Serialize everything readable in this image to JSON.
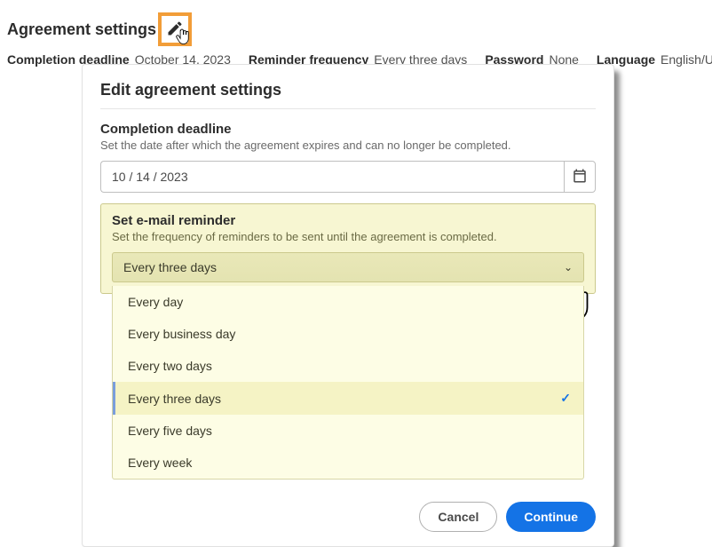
{
  "header": {
    "title": "Agreement settings",
    "items": [
      {
        "label": "Completion deadline",
        "value": "October 14, 2023"
      },
      {
        "label": "Reminder frequency",
        "value": "Every three days"
      },
      {
        "label": "Password",
        "value": "None"
      },
      {
        "label": "Language",
        "value": "English/UK"
      }
    ]
  },
  "modal": {
    "title": "Edit agreement settings",
    "deadline": {
      "label": "Completion deadline",
      "desc": "Set the date after which the agreement expires and can no longer be completed.",
      "value": "10 / 14 / 2023"
    },
    "reminder": {
      "label": "Set e-mail reminder",
      "desc": "Set the frequency of reminders to be sent until the agreement is completed.",
      "selected": "Every three days",
      "options": [
        "Every day",
        "Every business day",
        "Every two days",
        "Every three days",
        "Every five days",
        "Every week"
      ]
    },
    "buttons": {
      "cancel": "Cancel",
      "continue": "Continue"
    }
  },
  "icons": {
    "edit": "pencil-icon",
    "calendar": "calendar-icon",
    "chevron": "chevron-down-icon"
  },
  "colors": {
    "highlight": "#F29D38",
    "primary": "#1473E6"
  }
}
